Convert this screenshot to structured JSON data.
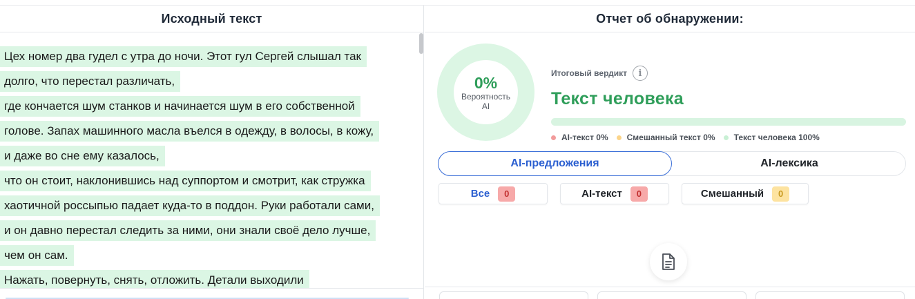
{
  "left_panel": {
    "title": "Исходный текст",
    "lines": [
      "Цех номер два гудел с утра до ночи. Этот гул Сергей слышал так",
      "долго, что перестал различать,",
      "где кончается шум станков и начинается шум в его собственной",
      "голове. Запах машинного масла въелся в одежду, в волосы, в кожу,",
      "и даже во сне ему казалось,",
      "что он стоит, наклонившись над суппортом и смотрит, как стружка",
      "хаотичной россыпью падает куда-то в поддон. Руки работали сами,",
      "и он давно перестал следить за ними, они знали своё дело лучше,",
      "чем он сам.",
      "Нажать, повернуть, снять, отложить. Детали выходили"
    ],
    "highlight_color": "#dbf6e4"
  },
  "right_panel": {
    "title": "Отчет об обнаружении:",
    "probability": {
      "value": "0%",
      "label": "Вероятность AI"
    },
    "verdict": {
      "label": "Итоговый вердикт",
      "value": "Текст человека",
      "color": "#2f9e5a",
      "human_fraction": 1.0
    },
    "legend": [
      {
        "label": "AI-текст 0%",
        "color": "#f29b9b"
      },
      {
        "label": "Смешанный текст 0%",
        "color": "#fbd48a"
      },
      {
        "label": "Текст человека 100%",
        "color": "#c8f0d4"
      }
    ],
    "tabs": [
      {
        "label": "AI-предложения",
        "active": true
      },
      {
        "label": "AI-лексика",
        "active": false
      }
    ],
    "filters": [
      {
        "label": "Все",
        "count": "0",
        "badge": "red",
        "label_color": "#2b5fd0"
      },
      {
        "label": "AI-текст",
        "count": "0",
        "badge": "red",
        "label_color": "#1f2328"
      },
      {
        "label": "Смешанный",
        "count": "0",
        "badge": "yellow",
        "label_color": "#1f2328"
      }
    ],
    "icons": {
      "info": "info-icon",
      "document": "document-icon"
    }
  }
}
